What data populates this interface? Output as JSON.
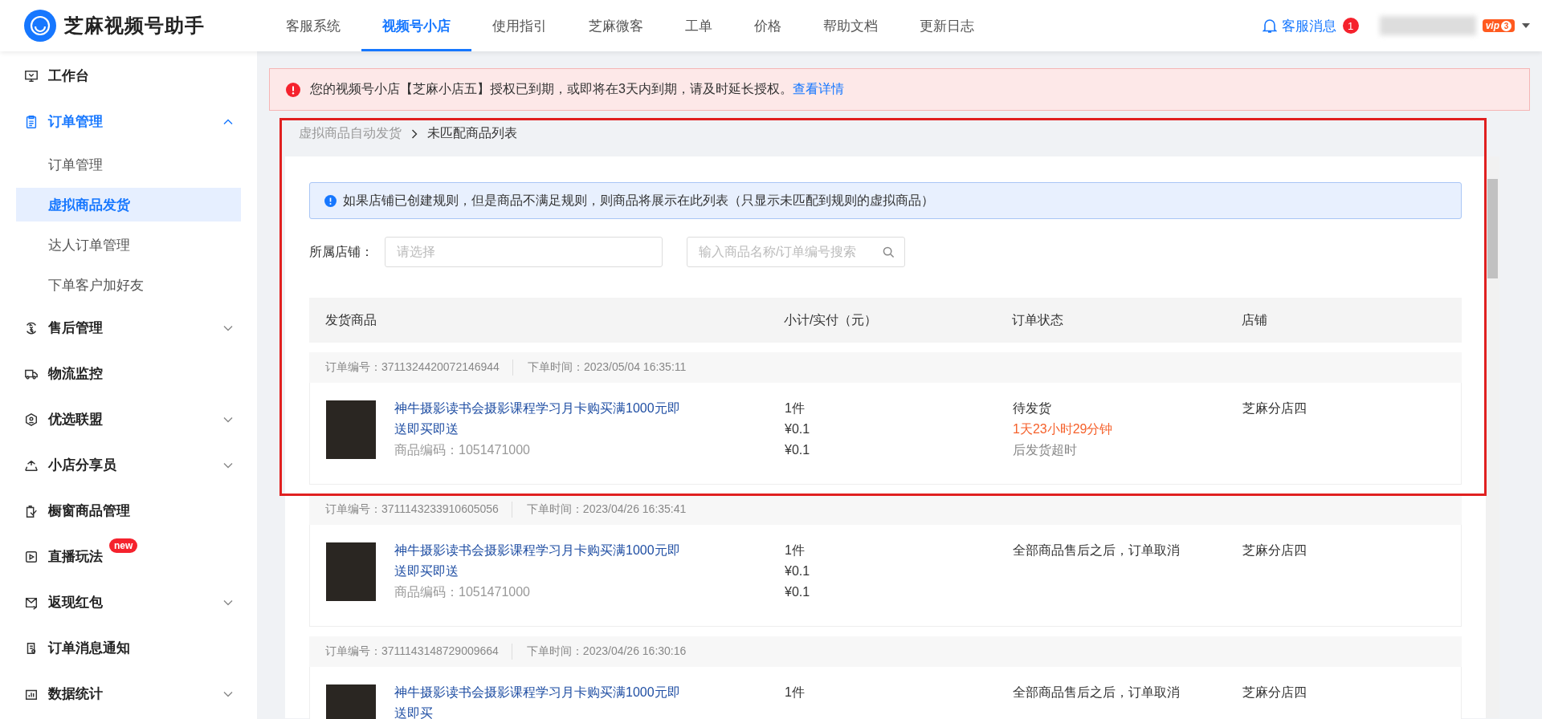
{
  "brand": {
    "name": "芝麻视频号助手"
  },
  "nav": [
    {
      "label": "客服系统",
      "selected": false
    },
    {
      "label": "视频号小店",
      "selected": true
    },
    {
      "label": "使用指引",
      "selected": false
    },
    {
      "label": "芝麻微客",
      "selected": false
    },
    {
      "label": "工单",
      "selected": false
    },
    {
      "label": "价格",
      "selected": false
    },
    {
      "label": "帮助文档",
      "selected": false
    },
    {
      "label": "更新日志",
      "selected": false
    }
  ],
  "header": {
    "messages_label": "客服消息",
    "messages_count": "1",
    "vip_label": "vip",
    "vip_level": "3"
  },
  "sidebar": {
    "items": [
      {
        "label": "工作台",
        "selected": false
      },
      {
        "label": "订单管理",
        "selected": true,
        "expanded": true,
        "children": [
          {
            "label": "订单管理",
            "selected": false
          },
          {
            "label": "虚拟商品发货",
            "selected": true
          },
          {
            "label": "达人订单管理",
            "selected": false
          },
          {
            "label": "下单客户加好友",
            "selected": false
          }
        ]
      },
      {
        "label": "售后管理",
        "selected": false,
        "expanded": false
      },
      {
        "label": "物流监控",
        "selected": false
      },
      {
        "label": "优选联盟",
        "selected": false,
        "expanded": false
      },
      {
        "label": "小店分享员",
        "selected": false,
        "expanded": false
      },
      {
        "label": "橱窗商品管理",
        "selected": false
      },
      {
        "label": "直播玩法",
        "selected": false,
        "badge": "new"
      },
      {
        "label": "返现红包",
        "selected": false,
        "expanded": false
      },
      {
        "label": "订单消息通知",
        "selected": false
      },
      {
        "label": "数据统计",
        "selected": false,
        "expanded": false
      }
    ]
  },
  "alert": {
    "text": "您的视频号小店【芝麻小店五】授权已到期，或即将在3天内到期，请及时延长授权。",
    "link": "查看详情"
  },
  "breadcrumb": [
    "虚拟商品自动发货",
    "未匹配商品列表"
  ],
  "notice": "如果店铺已创建规则，但是商品不满足规则，则商品将展示在此列表（只显示未匹配到规则的虚拟商品）",
  "filters": {
    "shop_label": "所属店铺：",
    "shop_placeholder": "请选择",
    "search_placeholder": "输入商品名称/订单编号搜索"
  },
  "table": {
    "columns": [
      "发货商品",
      "小计/实付（元）",
      "订单状态",
      "店铺"
    ]
  },
  "orders": [
    {
      "order_no": "订单编号：3711324420072146944",
      "order_time": "下单时间：2023/05/04 16:35:11",
      "product": "神牛摄影读书会摄影课程学习月卡购买满1000元即送即买即送",
      "product_code": "商品编码：1051471000",
      "quantity": "1件",
      "subtotal": "¥0.1",
      "paid": "¥0.1",
      "status": [
        {
          "text": "待发货",
          "kind": "normal"
        },
        {
          "text": "1天23小时29分钟",
          "kind": "countdown"
        },
        {
          "text": "后发货超时",
          "kind": "muted"
        }
      ],
      "shop": "芝麻分店四"
    },
    {
      "order_no": "订单编号：3711143233910605056",
      "order_time": "下单时间：2023/04/26 16:35:41",
      "product": "神牛摄影读书会摄影课程学习月卡购买满1000元即送即买即送",
      "product_code": "商品编码：1051471000",
      "quantity": "1件",
      "subtotal": "¥0.1",
      "paid": "¥0.1",
      "status": [
        {
          "text": "全部商品售后之后，订单取消",
          "kind": "normal"
        }
      ],
      "shop": "芝麻分店四"
    },
    {
      "order_no": "订单编号：3711143148729009664",
      "order_time": "下单时间：2023/04/26 16:30:16",
      "product": "神牛摄影读书会摄影课程学习月卡购买满1000元即送即买",
      "quantity": "1件",
      "status": [
        {
          "text": "全部商品售后之后，订单取消",
          "kind": "normal"
        }
      ],
      "shop": "芝麻分店四"
    }
  ]
}
